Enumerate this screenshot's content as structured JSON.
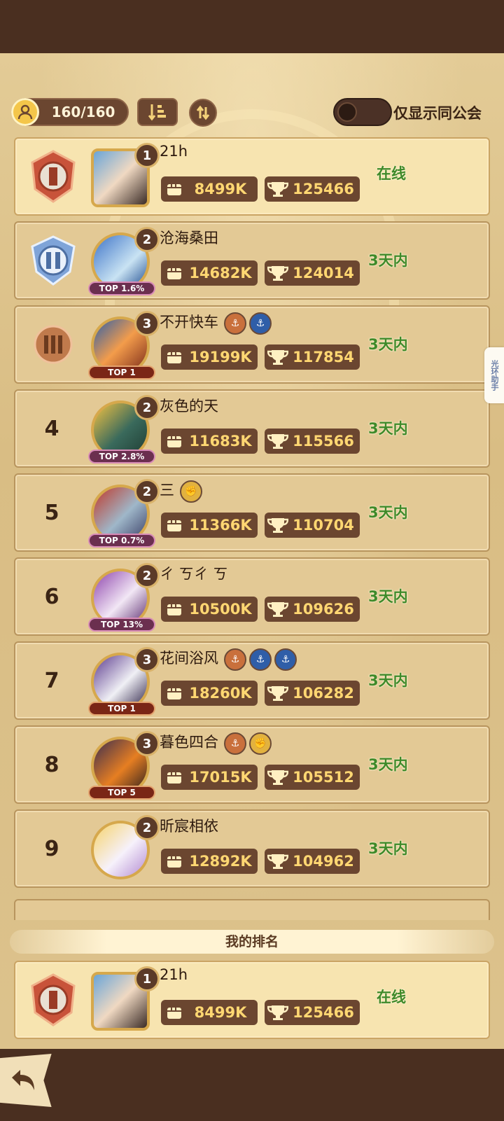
{
  "header": {
    "member_count": "160/160",
    "toggle_label": "仅显示同公会",
    "toggle_on": false
  },
  "side_tab": {
    "label": "光环助手"
  },
  "colors": {
    "panel_dark": "#6b4630",
    "stat_text": "#ffd772",
    "online_green": "#3f8a2a",
    "row_bg": "#e3c995",
    "my_row_bg": "#f7e4b0"
  },
  "rows": [
    {
      "rank": "1",
      "badge": "rank-1-badge",
      "level": "1",
      "name": "21h",
      "power": "8499K",
      "trophies": "125466",
      "status": "在线",
      "top_tag": "",
      "guild_icons": []
    },
    {
      "rank": "2",
      "badge": "rank-2-badge",
      "level": "2",
      "name": "沧海桑田",
      "power": "14682K",
      "trophies": "124014",
      "status": "3天内",
      "top_tag": "TOP 1.6%",
      "guild_icons": []
    },
    {
      "rank": "3",
      "badge": "rank-3-badge",
      "level": "3",
      "name": "不开快车",
      "power": "19199K",
      "trophies": "117854",
      "status": "3天内",
      "top_tag": "TOP 1",
      "guild_icons": [
        "bronze",
        "blue"
      ]
    },
    {
      "rank": "4",
      "badge": "",
      "level": "2",
      "name": "灰色的天",
      "power": "11683K",
      "trophies": "115566",
      "status": "3天内",
      "top_tag": "TOP 2.8%",
      "guild_icons": []
    },
    {
      "rank": "5",
      "badge": "",
      "level": "2",
      "name": "三",
      "power": "11366K",
      "trophies": "110704",
      "status": "3天内",
      "top_tag": "TOP 0.7%",
      "guild_icons": [
        "gold"
      ]
    },
    {
      "rank": "6",
      "badge": "",
      "level": "2",
      "name": "ㄔ ㄎㄔ ㄎ",
      "power": "10500K",
      "trophies": "109626",
      "status": "3天内",
      "top_tag": "TOP 13%",
      "guild_icons": []
    },
    {
      "rank": "7",
      "badge": "",
      "level": "3",
      "name": "花间浴风",
      "power": "18260K",
      "trophies": "106282",
      "status": "3天内",
      "top_tag": "TOP 1",
      "guild_icons": [
        "bronze",
        "blue",
        "blue"
      ]
    },
    {
      "rank": "8",
      "badge": "",
      "level": "3",
      "name": "暮色四合",
      "power": "17015K",
      "trophies": "105512",
      "status": "3天内",
      "top_tag": "TOP 5",
      "guild_icons": [
        "bronze",
        "gold"
      ]
    },
    {
      "rank": "9",
      "badge": "",
      "level": "2",
      "name": "昕宸相依",
      "power": "12892K",
      "trophies": "104962",
      "status": "3天内",
      "top_tag": "",
      "guild_icons": []
    }
  ],
  "my_rank": {
    "title": "我的排名",
    "rank": "1",
    "level": "1",
    "name": "21h",
    "power": "8499K",
    "trophies": "125466",
    "status": "在线"
  }
}
